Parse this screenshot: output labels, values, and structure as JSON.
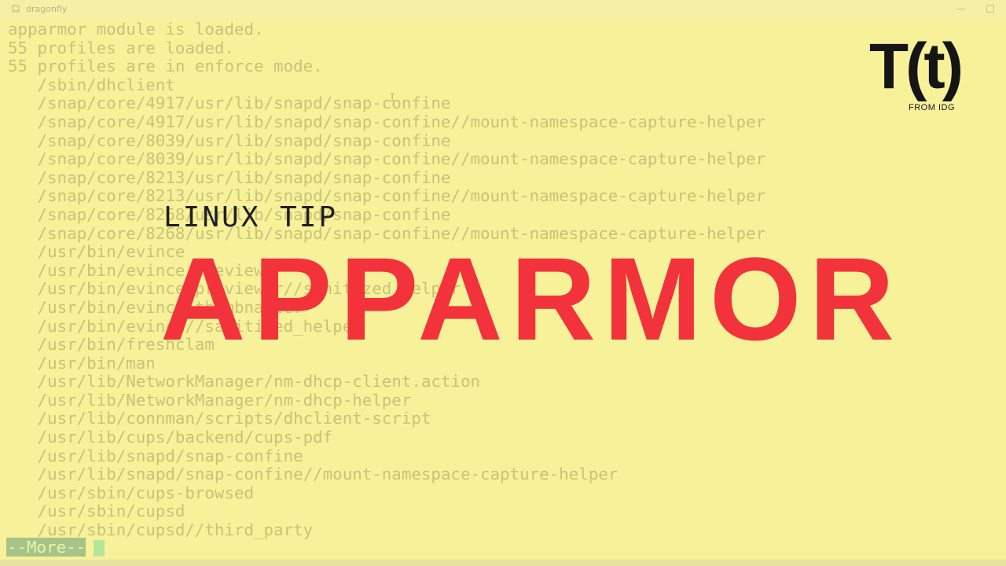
{
  "window": {
    "title": "dragonfly",
    "icon": "terminal-app-icon"
  },
  "terminal": {
    "lines": [
      "apparmor module is loaded.",
      "55 profiles are loaded.",
      "55 profiles are in enforce mode.",
      "   /sbin/dhclient",
      "   /snap/core/4917/usr/lib/snapd/snap-confine",
      "   /snap/core/4917/usr/lib/snapd/snap-confine//mount-namespace-capture-helper",
      "   /snap/core/8039/usr/lib/snapd/snap-confine",
      "   /snap/core/8039/usr/lib/snapd/snap-confine//mount-namespace-capture-helper",
      "   /snap/core/8213/usr/lib/snapd/snap-confine",
      "   /snap/core/8213/usr/lib/snapd/snap-confine//mount-namespace-capture-helper",
      "   /snap/core/8268/usr/lib/snapd/snap-confine",
      "   /snap/core/8268/usr/lib/snapd/snap-confine//mount-namespace-capture-helper",
      "   /usr/bin/evince",
      "   /usr/bin/evince-previewer",
      "   /usr/bin/evince-previewer//sanitized_helper",
      "   /usr/bin/evince-thumbnailer",
      "   /usr/bin/evince//sanitized_helper",
      "   /usr/bin/freshclam",
      "   /usr/bin/man",
      "   /usr/lib/NetworkManager/nm-dhcp-client.action",
      "   /usr/lib/NetworkManager/nm-dhcp-helper",
      "   /usr/lib/connman/scripts/dhclient-script",
      "   /usr/lib/cups/backend/cups-pdf",
      "   /usr/lib/snapd/snap-confine",
      "   /usr/lib/snapd/snap-confine//mount-namespace-capture-helper",
      "   /usr/sbin/cups-browsed",
      "   /usr/sbin/cupsd",
      "   /usr/sbin/cupsd//third_party"
    ],
    "pager_prompt": "--More--",
    "cursor_glyph": "I"
  },
  "overlay": {
    "subtitle": "LINUX TIP",
    "title": "APPARMOR"
  },
  "logo": {
    "mark": "T(t)",
    "tagline": "FROM IDG"
  },
  "colors": {
    "background": "#f7f19a",
    "terminal_text": "#c9c278",
    "title_red": "#f2333b",
    "logo_dark": "#151515",
    "pager_bg": "#a6c48a"
  }
}
